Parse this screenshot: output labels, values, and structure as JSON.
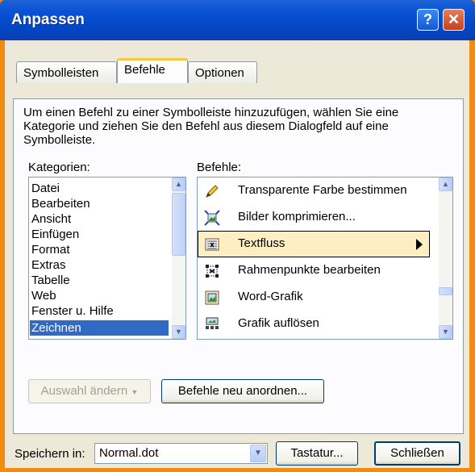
{
  "window": {
    "title": "Anpassen",
    "help_glyph": "?",
    "close_glyph": "✕"
  },
  "tabs": [
    {
      "label": "Symbolleisten",
      "active": false
    },
    {
      "label": "Befehle",
      "active": true
    },
    {
      "label": "Optionen",
      "active": false
    }
  ],
  "description": "Um einen Befehl zu einer Symbolleiste hinzuzufügen, wählen Sie eine Kategorie und ziehen Sie den Befehl aus diesem Dialogfeld auf eine Symbolleiste.",
  "categories": {
    "label": "Kategorien:",
    "items": [
      "Datei",
      "Bearbeiten",
      "Ansicht",
      "Einfügen",
      "Format",
      "Extras",
      "Tabelle",
      "Web",
      "Fenster u. Hilfe",
      "Zeichnen"
    ],
    "selected": "Zeichnen"
  },
  "commands": {
    "label": "Befehle:",
    "items": [
      {
        "label": "Transparente Farbe bestimmen",
        "icon": "pen-icon"
      },
      {
        "label": "Bilder komprimieren...",
        "icon": "compress-pictures-icon"
      },
      {
        "label": "Textfluss",
        "icon": "text-wrap-icon",
        "highlighted": true,
        "submenu": true
      },
      {
        "label": "Rahmenpunkte bearbeiten",
        "icon": "edit-points-icon"
      },
      {
        "label": "Word-Grafik",
        "icon": "word-picture-icon"
      },
      {
        "label": "Grafik auflösen",
        "icon": "ungroup-picture-icon"
      }
    ]
  },
  "buttons": {
    "modify_selection": "Auswahl ändern",
    "rearrange_commands": "Befehle neu anordnen...",
    "keyboard": "Tastatur...",
    "close": "Schließen"
  },
  "save_in": {
    "label": "Speichern in:",
    "value": "Normal.dot"
  },
  "colors": {
    "title_bar": "#0a51d4",
    "selection": "#316ac5",
    "highlight": "#ffeec2",
    "frame": "#f28b12"
  }
}
